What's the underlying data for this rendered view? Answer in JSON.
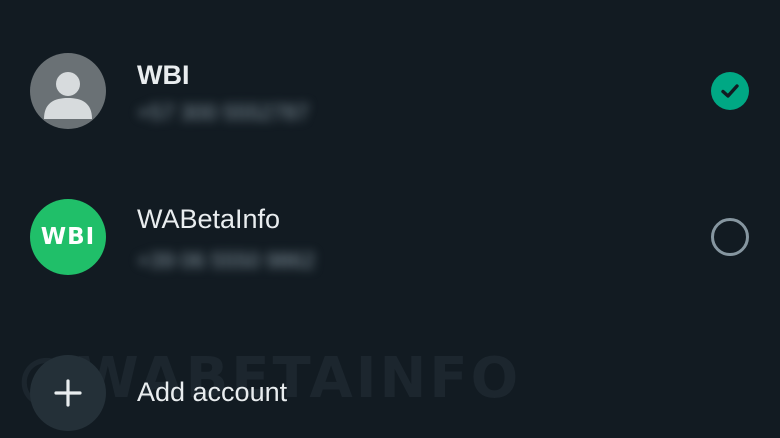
{
  "accounts": [
    {
      "name": "WBI",
      "phone": "+57 300 5552787",
      "avatar": "default-avatar-icon",
      "selected": true
    },
    {
      "name": "WABetaInfo",
      "phone": "+39 06 5550 9862",
      "avatar_text": "WBI",
      "selected": false
    }
  ],
  "add_account": {
    "label": "Add account",
    "icon": "plus-icon"
  },
  "watermark": "@WABETAINFO",
  "colors": {
    "background": "#121b22",
    "accent": "#00a884",
    "wbi_avatar": "#20bf69",
    "text_primary": "#e9edef",
    "text_secondary": "#8696a0"
  }
}
